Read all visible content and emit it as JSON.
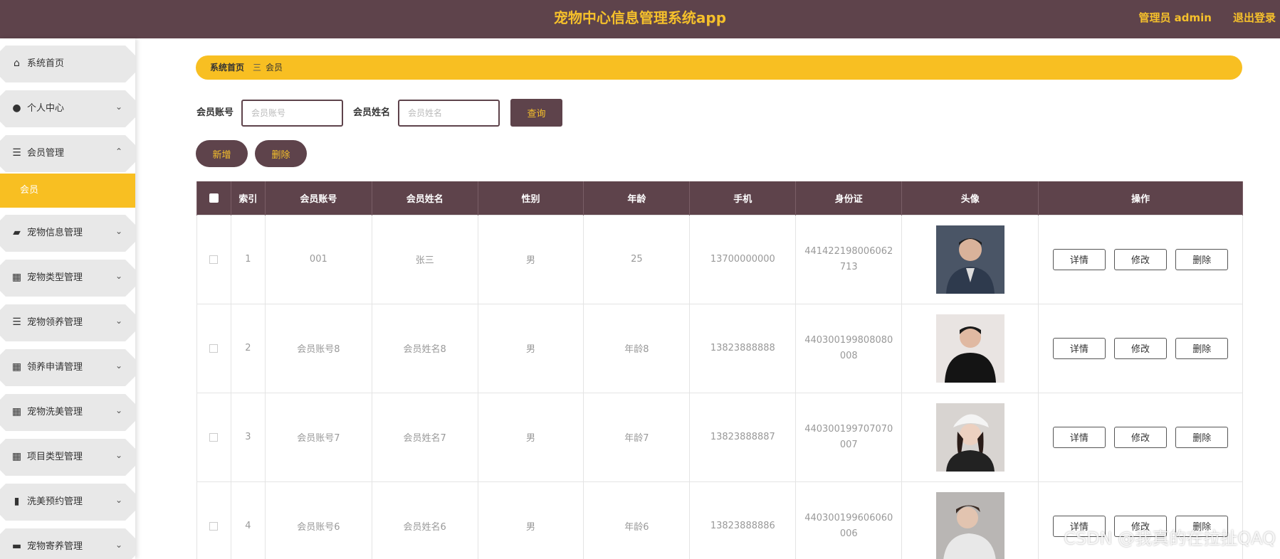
{
  "header": {
    "title": "宠物中心信息管理系统app",
    "admin": "管理员 admin",
    "logout": "退出登录"
  },
  "sidebar": {
    "items": [
      {
        "label": "系统首页",
        "icon": "home-icon",
        "glyph": "⌂",
        "chevron": ""
      },
      {
        "label": "个人中心",
        "icon": "user-icon",
        "glyph": "●",
        "chevron": "⌄"
      },
      {
        "label": "会员管理",
        "icon": "list-icon",
        "glyph": "☰",
        "chevron": "⌃"
      },
      {
        "label": "宠物信息管理",
        "icon": "wallet-icon",
        "glyph": "▰",
        "chevron": "⌄"
      },
      {
        "label": "宠物类型管理",
        "icon": "grid-icon",
        "glyph": "▦",
        "chevron": "⌄"
      },
      {
        "label": "宠物领养管理",
        "icon": "list-icon",
        "glyph": "☰",
        "chevron": "⌄"
      },
      {
        "label": "领养申请管理",
        "icon": "grid-icon",
        "glyph": "▦",
        "chevron": "⌄"
      },
      {
        "label": "宠物洗美管理",
        "icon": "grid-icon",
        "glyph": "▦",
        "chevron": "⌄"
      },
      {
        "label": "项目类型管理",
        "icon": "grid-icon",
        "glyph": "▦",
        "chevron": "⌄"
      },
      {
        "label": "洗美预约管理",
        "icon": "bar-chart-icon",
        "glyph": "▮",
        "chevron": "⌄"
      },
      {
        "label": "宠物寄养管理",
        "icon": "monitor-icon",
        "glyph": "▬",
        "chevron": "⌄"
      }
    ],
    "submenu_active": "会员"
  },
  "breadcrumb": {
    "home": "系统首页",
    "separator": "三",
    "current": "会员"
  },
  "search": {
    "account_label": "会员账号",
    "account_placeholder": "会员账号",
    "name_label": "会员姓名",
    "name_placeholder": "会员姓名",
    "query_button": "查询"
  },
  "actions": {
    "add": "新增",
    "delete": "删除"
  },
  "table": {
    "headers": [
      "",
      "索引",
      "会员账号",
      "会员姓名",
      "性别",
      "年龄",
      "手机",
      "身份证",
      "头像",
      "操作"
    ],
    "rows": [
      {
        "index": "1",
        "account": "001",
        "name": "张三",
        "gender": "男",
        "age": "25",
        "phone": "13700000000",
        "idcard": "441422198006062713"
      },
      {
        "index": "2",
        "account": "会员账号8",
        "name": "会员姓名8",
        "gender": "男",
        "age": "年龄8",
        "phone": "13823888888",
        "idcard": "440300199808080008"
      },
      {
        "index": "3",
        "account": "会员账号7",
        "name": "会员姓名7",
        "gender": "男",
        "age": "年龄7",
        "phone": "13823888887",
        "idcard": "440300199707070007"
      },
      {
        "index": "4",
        "account": "会员账号6",
        "name": "会员姓名6",
        "gender": "男",
        "age": "年龄6",
        "phone": "13823888886",
        "idcard": "440300199606060006"
      }
    ],
    "op_buttons": [
      "详情",
      "修改",
      "删除"
    ]
  },
  "watermark": "CSDN @我真的在拉扯QAQ",
  "colors": {
    "primary": "#5e434b",
    "accent": "#f8bf22"
  }
}
